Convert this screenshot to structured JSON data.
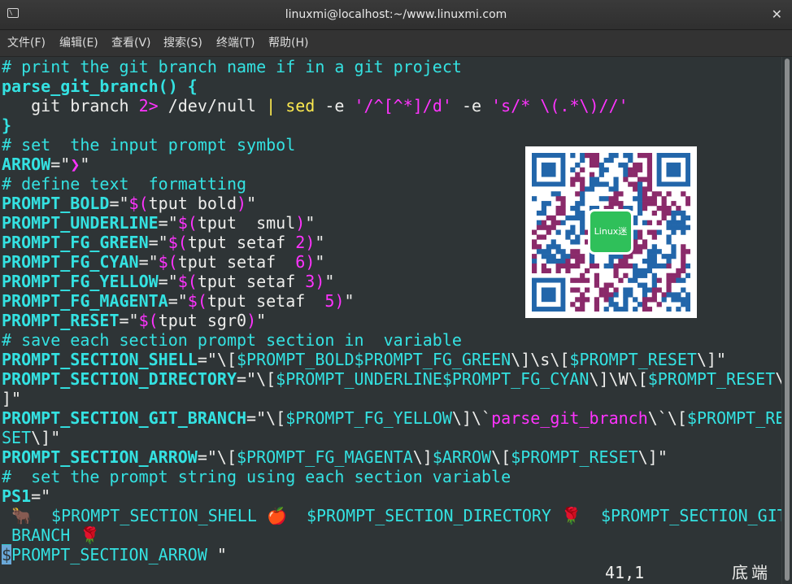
{
  "window": {
    "title": "linuxmi@localhost:~/www.linuxmi.com",
    "app_icon": "terminal-icon",
    "app_icon_glyph": "\\",
    "close_glyph": "✕"
  },
  "menu": [
    "文件(F)",
    "编辑(E)",
    "查看(V)",
    "搜索(S)",
    "终端(T)",
    "帮助(H)"
  ],
  "editor": {
    "lines": [
      [
        [
          "# print the git branch name if in a git project",
          "comment"
        ]
      ],
      [
        [
          "parse_git_branch() {",
          "ident"
        ]
      ],
      [
        [
          "   git branch ",
          "white"
        ],
        [
          "2>",
          "mag"
        ],
        [
          " /dev/null ",
          "white"
        ],
        [
          "|",
          "yellow"
        ],
        [
          " ",
          "white"
        ],
        [
          "sed",
          "yellow"
        ],
        [
          " -e ",
          "white"
        ],
        [
          "'/^[^*]/d'",
          "mag"
        ],
        [
          " -e ",
          "white"
        ],
        [
          "'s/* \\(.*\\)//'",
          "mag"
        ]
      ],
      [
        [
          "}",
          "ident"
        ]
      ],
      [
        [
          "# set  the input prompt symbol",
          "comment"
        ]
      ],
      [
        [
          "ARROW",
          "ident"
        ],
        [
          "=\"",
          "white"
        ],
        [
          "❯",
          "mag"
        ],
        [
          "\"",
          "white"
        ]
      ],
      [
        [
          "# define text  formatting",
          "comment"
        ]
      ],
      [
        [
          "PROMPT_BOLD",
          "ident"
        ],
        [
          "=\"",
          "white"
        ],
        [
          "$(",
          "mag"
        ],
        [
          "tput bold",
          "white"
        ],
        [
          ")",
          "mag"
        ],
        [
          "\"",
          "white"
        ]
      ],
      [
        [
          "PROMPT_UNDERLINE",
          "ident"
        ],
        [
          "=\"",
          "white"
        ],
        [
          "$(",
          "mag"
        ],
        [
          "tput  smul",
          "white"
        ],
        [
          ")",
          "mag"
        ],
        [
          "\"",
          "white"
        ]
      ],
      [
        [
          "PROMPT_FG_GREEN",
          "ident"
        ],
        [
          "=\"",
          "white"
        ],
        [
          "$(",
          "mag"
        ],
        [
          "tput setaf ",
          "white"
        ],
        [
          "2",
          "mag"
        ],
        [
          ")",
          "mag"
        ],
        [
          "\"",
          "white"
        ]
      ],
      [
        [
          "PROMPT_FG_CYAN",
          "ident"
        ],
        [
          "=\"",
          "white"
        ],
        [
          "$(",
          "mag"
        ],
        [
          "tput setaf  ",
          "white"
        ],
        [
          "6",
          "mag"
        ],
        [
          ")",
          "mag"
        ],
        [
          "\"",
          "white"
        ]
      ],
      [
        [
          "PROMPT_FG_YELLOW",
          "ident"
        ],
        [
          "=\"",
          "white"
        ],
        [
          "$(",
          "mag"
        ],
        [
          "tput setaf ",
          "white"
        ],
        [
          "3",
          "mag"
        ],
        [
          ")",
          "mag"
        ],
        [
          "\"",
          "white"
        ]
      ],
      [
        [
          "PROMPT_FG_MAGENTA",
          "ident"
        ],
        [
          "=\"",
          "white"
        ],
        [
          "$(",
          "mag"
        ],
        [
          "tput setaf  ",
          "white"
        ],
        [
          "5",
          "mag"
        ],
        [
          ")",
          "mag"
        ],
        [
          "\"",
          "white"
        ]
      ],
      [
        [
          "PROMPT_RESET",
          "ident"
        ],
        [
          "=\"",
          "white"
        ],
        [
          "$(",
          "mag"
        ],
        [
          "tput sgr0",
          "white"
        ],
        [
          ")",
          "mag"
        ],
        [
          "\"",
          "white"
        ]
      ],
      [
        [
          "# save each section prompt section in  variable",
          "comment"
        ]
      ],
      [
        [
          "PROMPT_SECTION_SHELL",
          "ident"
        ],
        [
          "=\"\\[",
          "white"
        ],
        [
          "$PROMPT_BOLD$PROMPT_FG_GREEN",
          "var"
        ],
        [
          "\\]\\s\\[",
          "white"
        ],
        [
          "$PROMPT_RESET",
          "var"
        ],
        [
          "\\]\"",
          "white"
        ]
      ],
      [
        [
          "PROMPT_SECTION_DIRECTORY",
          "ident"
        ],
        [
          "=\"\\[",
          "white"
        ],
        [
          "$PROMPT_UNDERLINE$PROMPT_FG_CYAN",
          "var"
        ],
        [
          "\\]\\W\\[",
          "white"
        ],
        [
          "$PROMPT_RESET",
          "var"
        ],
        [
          "\\",
          "white"
        ]
      ],
      [
        [
          "]\"",
          "white"
        ]
      ],
      [
        [
          "PROMPT_SECTION_GIT_BRANCH",
          "ident"
        ],
        [
          "=\"\\[",
          "white"
        ],
        [
          "$PROMPT_FG_YELLOW",
          "var"
        ],
        [
          "\\]\\`",
          "white"
        ],
        [
          "parse_git_branch",
          "mag"
        ],
        [
          "\\`\\[",
          "white"
        ],
        [
          "$PROMPT_RE",
          "var"
        ]
      ],
      [
        [
          "SET",
          "var"
        ],
        [
          "\\]\"",
          "white"
        ]
      ],
      [
        [
          "PROMPT_SECTION_ARROW",
          "ident"
        ],
        [
          "=\"\\[",
          "white"
        ],
        [
          "$PROMPT_FG_MAGENTA",
          "var"
        ],
        [
          "\\]",
          "white"
        ],
        [
          "$ARROW",
          "var"
        ],
        [
          "\\[",
          "white"
        ],
        [
          "$PROMPT_RESET",
          "var"
        ],
        [
          "\\]\"",
          "white"
        ]
      ],
      [
        [
          "#  set the prompt string using each section variable",
          "comment"
        ]
      ],
      [
        [
          "PS1",
          "ident"
        ],
        [
          "=\"",
          "white"
        ]
      ],
      [
        [
          " 🐂  ",
          "white"
        ],
        [
          "$PROMPT_SECTION_SHELL",
          "var"
        ],
        [
          " 🍎  ",
          "white"
        ],
        [
          "$PROMPT_SECTION_DIRECTORY",
          "var"
        ],
        [
          " 🌹  ",
          "white"
        ],
        [
          "$PROMPT_SECTION_GIT",
          "var"
        ]
      ],
      [
        [
          "_BRANCH",
          "var"
        ],
        [
          " 🌹",
          "white"
        ]
      ],
      [
        [
          "$",
          "cursor"
        ],
        [
          "PROMPT_SECTION_ARROW",
          "var"
        ],
        [
          " \"",
          "white"
        ]
      ]
    ]
  },
  "qr": {
    "badge_text": "Linux迷"
  },
  "status": {
    "position": "41,1",
    "location": "底端"
  },
  "colors": {
    "background": "#2e3436",
    "comment": "#34e2e2",
    "yellow": "#fce94f",
    "magenta": "#ff33ff",
    "qr_green": "#2fc05a",
    "qr_blue": "#2266aa",
    "qr_purple": "#8a2a6a"
  }
}
